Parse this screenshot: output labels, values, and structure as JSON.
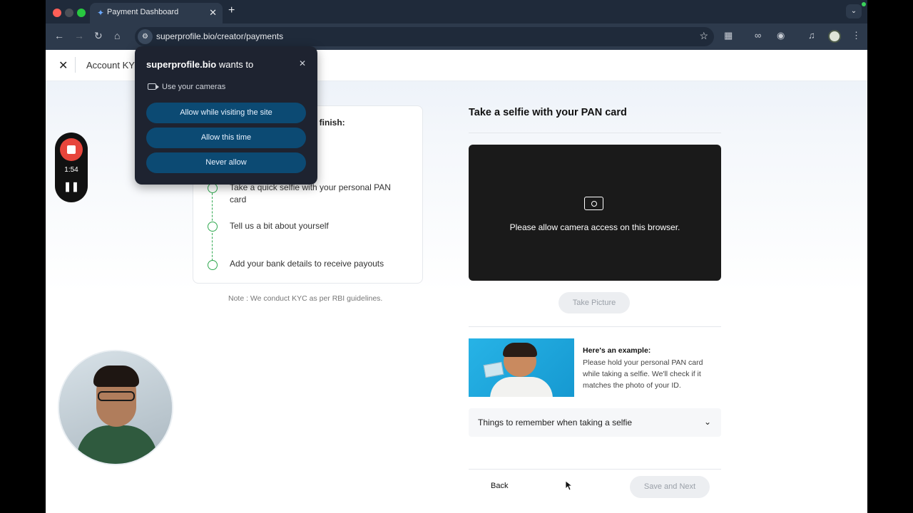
{
  "browser": {
    "tab_title": "Payment Dashboard",
    "url": "superprofile.bio/creator/payments"
  },
  "page": {
    "header_title": "Account KY"
  },
  "steps": {
    "heading_fragment": "o finish:",
    "items": [
      "Take a quick selfie with your personal PAN card",
      "Tell us a bit about yourself",
      "Add your bank details to receive payouts"
    ],
    "note": "Note : We conduct KYC as per RBI guidelines."
  },
  "selfie": {
    "title": "Take a selfie with your PAN card",
    "camera_message": "Please allow camera access on this browser.",
    "take_picture": "Take Picture",
    "example_title": "Here's an example:",
    "example_text": "Please hold your personal PAN card while taking a selfie. We'll check if it matches the photo of your ID.",
    "accordion_label": "Things to remember when taking a selfie",
    "back_label": "Back",
    "next_label": "Save and Next"
  },
  "permission_popup": {
    "site": "superprofile.bio",
    "title_suffix": " wants to",
    "permission": "Use your cameras",
    "allow_site": "Allow while visiting the site",
    "allow_once": "Allow this time",
    "never": "Never allow"
  },
  "recorder": {
    "time": "1:54"
  },
  "colors": {
    "accent_green": "#2fa84f",
    "popup_button": "#0c4a73",
    "record_red": "#e7453b"
  }
}
